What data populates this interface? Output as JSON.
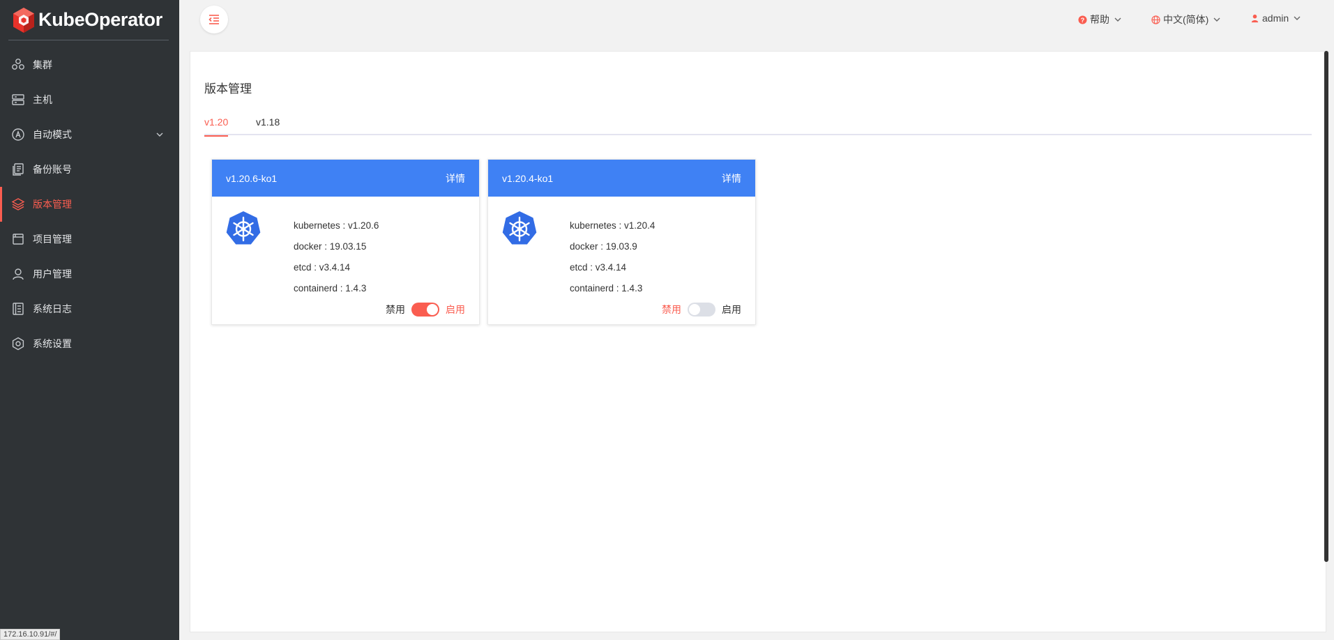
{
  "app": {
    "name": "KubeOperator",
    "brand_color": "#fa5d50",
    "sidebar_bg": "#2f3336"
  },
  "sidebar": {
    "items": [
      {
        "label": "集群",
        "icon": "cluster-icon",
        "active": false
      },
      {
        "label": "主机",
        "icon": "server-icon",
        "active": false
      },
      {
        "label": "自动模式",
        "icon": "auto-mode-icon",
        "active": false,
        "expandable": true
      },
      {
        "label": "备份账号",
        "icon": "backup-icon",
        "active": false
      },
      {
        "label": "版本管理",
        "icon": "layers-icon",
        "active": true
      },
      {
        "label": "项目管理",
        "icon": "project-icon",
        "active": false
      },
      {
        "label": "用户管理",
        "icon": "user-icon",
        "active": false
      },
      {
        "label": "系统日志",
        "icon": "log-icon",
        "active": false
      },
      {
        "label": "系统设置",
        "icon": "settings-icon",
        "active": false
      }
    ]
  },
  "status_bar": {
    "url": "172.16.10.91/#/"
  },
  "header": {
    "help": "帮助",
    "language": "中文(简体)",
    "user": "admin"
  },
  "page": {
    "title": "版本管理",
    "tabs": [
      {
        "label": "v1.20",
        "active": true
      },
      {
        "label": "v1.18",
        "active": false
      }
    ]
  },
  "cards": [
    {
      "name": "v1.20.6-ko1",
      "detail": "详情",
      "kubernetes": "kubernetes : v1.20.6",
      "docker": "docker : 19.03.15",
      "etcd": "etcd : v3.4.14",
      "containerd": "containerd : 1.4.3",
      "disable_label": "禁用",
      "enable_label": "启用",
      "enabled": true
    },
    {
      "name": "v1.20.4-ko1",
      "detail": "详情",
      "kubernetes": "kubernetes : v1.20.4",
      "docker": "docker : 19.03.9",
      "etcd": "etcd : v3.4.14",
      "containerd": "containerd : 1.4.3",
      "disable_label": "禁用",
      "enable_label": "启用",
      "enabled": false
    }
  ]
}
